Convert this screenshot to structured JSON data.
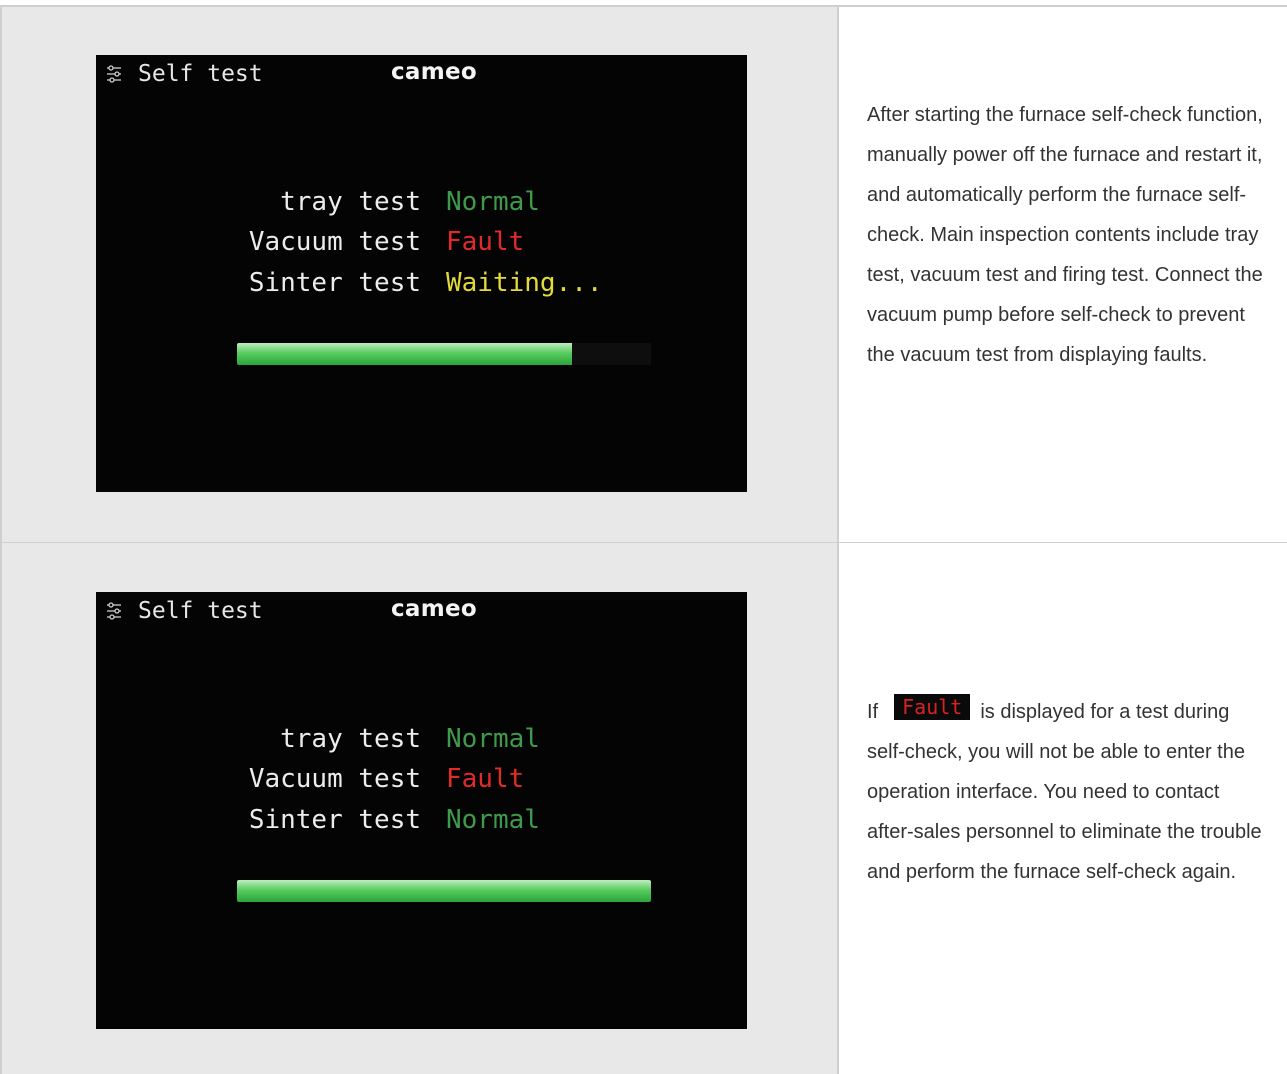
{
  "screen_top": {
    "header_title": "Self test",
    "brand": "cameo",
    "tests": [
      {
        "label": "tray test",
        "status": "Normal",
        "state": "normal"
      },
      {
        "label": "Vacuum test",
        "status": "Fault",
        "state": "fault"
      },
      {
        "label": "Sinter test",
        "status": "Waiting...",
        "state": "waiting"
      }
    ],
    "progress": 0.81
  },
  "screen_bottom": {
    "header_title": "Self test",
    "brand": "cameo",
    "tests": [
      {
        "label": "tray test",
        "status": "Normal",
        "state": "normal"
      },
      {
        "label": "Vacuum test",
        "status": "Fault",
        "state": "fault"
      },
      {
        "label": "Sinter test",
        "status": "Normal",
        "state": "normal"
      }
    ],
    "progress": 1.0
  },
  "text_top": "After starting the furnace self-check function, manually power off the furnace and restart it, and automatically perform the furnace self-check. Main inspection contents include tray test, vacuum test and firing test. Connect the vacuum pump before self-check to prevent the vacuum test from displaying faults.",
  "text_bottom": {
    "prefix": "If",
    "badge": "Fault",
    "suffix": "is displayed for a test during self-check, you will not be able to enter the operation interface. You need to contact after-sales personnel to eliminate the trouble and perform the furnace self-check again."
  },
  "colors": {
    "normal": "#3f9a4c",
    "fault": "#e22a2a",
    "waiting": "#e2da3a",
    "progress": "#4cc456"
  },
  "icons": {
    "header": "settings-sliders-icon"
  }
}
